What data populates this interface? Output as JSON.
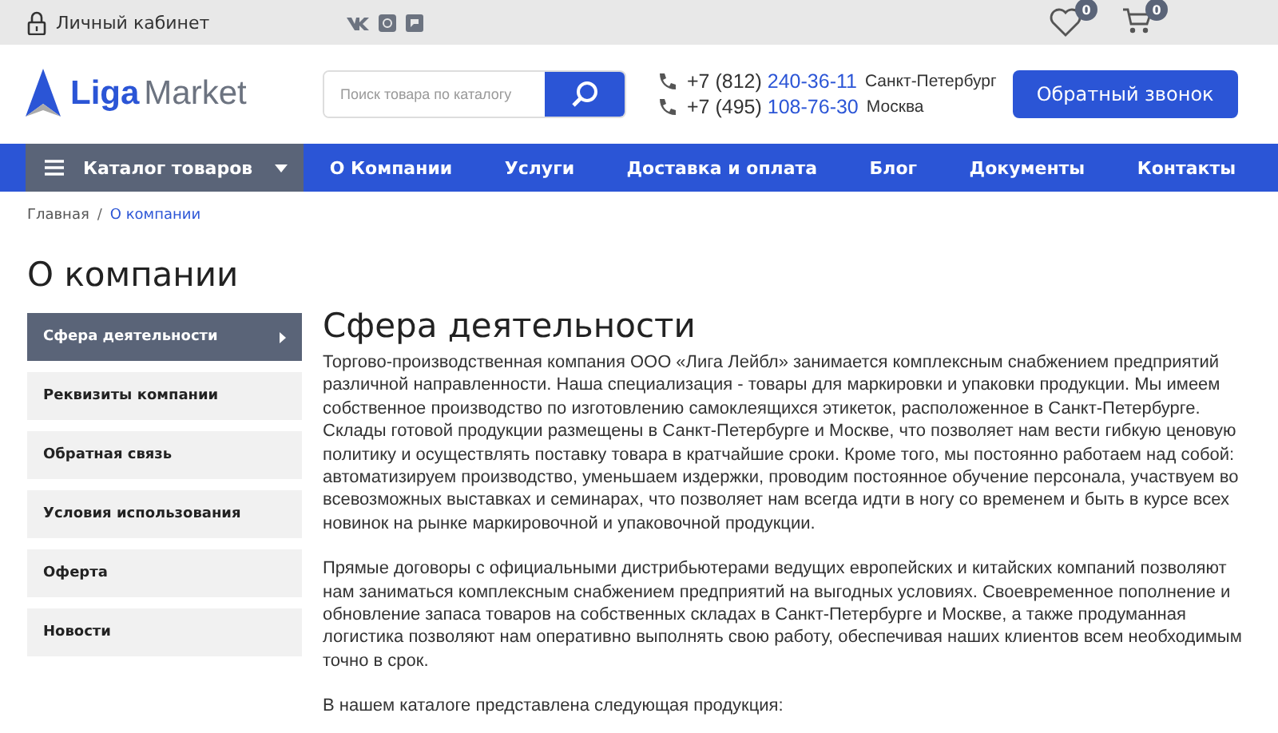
{
  "topbar": {
    "account": "Личный кабинет",
    "social": [
      {
        "kind": "vk"
      },
      {
        "kind": "instagram"
      },
      {
        "kind": "chat"
      }
    ],
    "favorites_count": "0",
    "cart_count": "0"
  },
  "header": {
    "logo": {
      "bold": "Liga",
      "light": "Market"
    },
    "search": {
      "placeholder": "Поиск товара по каталогу"
    },
    "phones": [
      {
        "prefix": "+7 (812)",
        "number": "240-36-11",
        "city": "Санкт-Петербург"
      },
      {
        "prefix": "+7 (495)",
        "number": "108-76-30",
        "city": "Москва"
      }
    ],
    "callback_button": "Обратный звонок"
  },
  "nav": {
    "catalog": "Каталог товаров",
    "items": [
      "О Компании",
      "Услуги",
      "Доставка и оплата",
      "Блог",
      "Документы",
      "Контакты"
    ]
  },
  "breadcrumb_separator": "/",
  "breadcrumbs": [
    {
      "label": "Главная",
      "current": false
    },
    {
      "label": "О компании",
      "current": true
    }
  ],
  "page_title": "О компании",
  "sidebar": {
    "items": [
      {
        "label": "Сфера деятельности",
        "selected": true
      },
      {
        "label": "Реквизиты компании",
        "selected": false
      },
      {
        "label": "Обратная связь",
        "selected": false
      },
      {
        "label": "Условия использования",
        "selected": false
      },
      {
        "label": "Оферта",
        "selected": false
      },
      {
        "label": "Новости",
        "selected": false
      }
    ]
  },
  "content": {
    "heading": "Сфера деятельности",
    "paragraphs": [
      "Торгово-производственная компания ООО «Лига Лейбл» занимается комплексным снабжением предприятий различной направленности. Наша специализация - товары для маркировки и упаковки продукции. Мы имеем собственное производство по изготовлению самоклеящихся этикеток, расположенное в Санкт-Петербурге. Склады готовой продукции размещены в Санкт-Петербурге и Москве, что позволяет нам вести гибкую ценовую политику и осуществлять поставку товара в кратчайшие сроки. Кроме того, мы постоянно работаем над собой: автоматизируем производство, уменьшаем издержки, проводим постоянное обучение персонала, участвуем во всевозможных выставках и семинарах, что позволяет нам всегда идти в ногу со временем и быть в курсе всех новинок на рынке маркировочной и упаковочной продукции.",
      "Прямые договоры с официальными дистрибьютерами ведущих европейских и китайских компаний позволяют нам заниматься комплексным снабжением предприятий на выгодных условиях. Своевременное пополнение и обновление запаса товаров на собственных складах в Санкт-Петербурге и Москве, а также продуманная логистика позволяют нам оперативно выполнять свою работу, обеспечивая наших клиентов всем необходимым точно в срок.",
      "В нашем каталоге представлена следующая продукция:"
    ]
  }
}
